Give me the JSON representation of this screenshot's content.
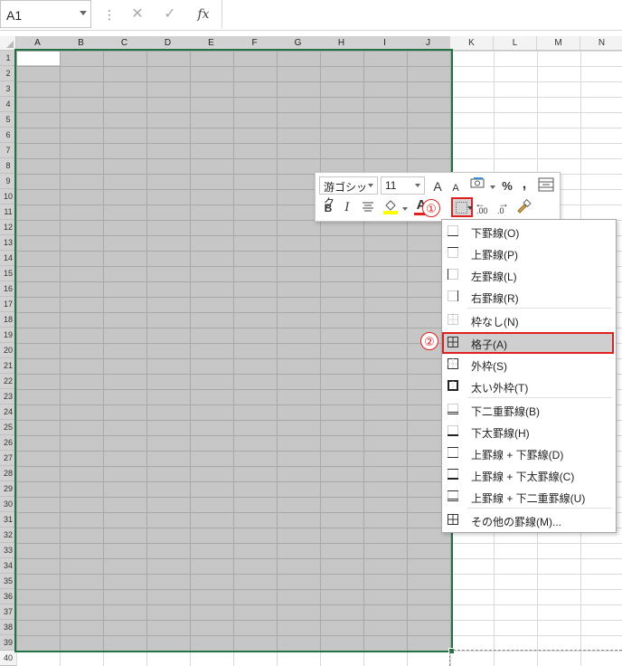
{
  "formula_bar": {
    "name_box": "A1",
    "more_glyph": "⋮",
    "cancel_glyph": "✕",
    "enter_glyph": "✓",
    "fx_label": "fx",
    "formula": ""
  },
  "columns": [
    "A",
    "B",
    "C",
    "D",
    "E",
    "F",
    "G",
    "H",
    "I",
    "J",
    "K",
    "L",
    "M",
    "N"
  ],
  "selected_columns": 10,
  "rows": [
    "1",
    "2",
    "3",
    "4",
    "5",
    "6",
    "7",
    "8",
    "9",
    "10",
    "11",
    "12",
    "13",
    "14",
    "15",
    "16",
    "17",
    "18",
    "19",
    "20",
    "21",
    "22",
    "23",
    "24",
    "25",
    "26",
    "27",
    "28",
    "29",
    "30",
    "31",
    "32",
    "33",
    "34",
    "35",
    "36",
    "37",
    "38",
    "39",
    "40"
  ],
  "selected_rows": 39,
  "mini_toolbar": {
    "font_name": "游ゴシック",
    "font_size": "11",
    "increase_font": "A",
    "decrease_font": "A",
    "percent": "%",
    "comma": ",",
    "bold": "B",
    "italic": "I",
    "font_color_letter": "A",
    "inc_decimal": ".00",
    "dec_decimal": ".0"
  },
  "callouts": {
    "step1": "①",
    "step2": "②"
  },
  "border_menu": [
    {
      "label": "下罫線(O)",
      "icon": "bottom-border-icon"
    },
    {
      "label": "上罫線(P)",
      "icon": "top-border-icon"
    },
    {
      "label": "左罫線(L)",
      "icon": "left-border-icon"
    },
    {
      "label": "右罫線(R)",
      "icon": "right-border-icon"
    },
    {
      "label": "枠なし(N)",
      "icon": "no-border-icon"
    },
    {
      "label": "格子(A)",
      "icon": "all-borders-icon",
      "highlighted": true
    },
    {
      "label": "外枠(S)",
      "icon": "outside-borders-icon"
    },
    {
      "label": "太い外枠(T)",
      "icon": "thick-box-border-icon"
    },
    {
      "label": "下二重罫線(B)",
      "icon": "bottom-double-border-icon"
    },
    {
      "label": "下太罫線(H)",
      "icon": "thick-bottom-border-icon"
    },
    {
      "label": "上罫線 + 下罫線(D)",
      "icon": "top-bottom-border-icon"
    },
    {
      "label": "上罫線 + 下太罫線(C)",
      "icon": "top-thick-bottom-border-icon"
    },
    {
      "label": "上罫線 + 下二重罫線(U)",
      "icon": "top-double-bottom-border-icon"
    },
    {
      "label": "その他の罫線(M)...",
      "icon": "more-borders-icon"
    }
  ],
  "colors": {
    "selection_border": "#217346",
    "highlight_red": "#e02020",
    "selected_fill": "#c6c6c6"
  }
}
